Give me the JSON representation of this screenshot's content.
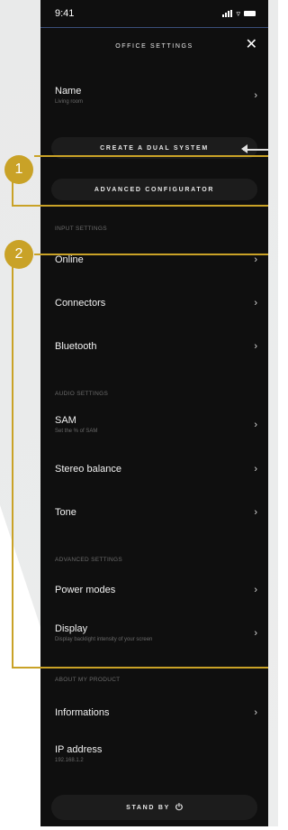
{
  "status_bar": {
    "time": "9:41"
  },
  "header": {
    "title": "OFFICE SETTINGS",
    "close_icon": "close-icon"
  },
  "name_row": {
    "label": "Name",
    "value": "Living room"
  },
  "dual_system_button": {
    "label": "CREATE A DUAL SYSTEM"
  },
  "advanced_configurator_button": {
    "label": "ADVANCED CONFIGURATOR"
  },
  "sections": {
    "input": "INPUT SETTINGS",
    "audio": "AUDIO SETTINGS",
    "advanced": "ADVANCED SETTINGS",
    "about": "ABOUT MY PRODUCT"
  },
  "input_items": [
    {
      "label": "Online"
    },
    {
      "label": "Connectors"
    },
    {
      "label": "Bluetooth"
    }
  ],
  "audio_items": [
    {
      "label": "SAM",
      "sub": "Set the % of SAM"
    },
    {
      "label": "Stereo balance"
    },
    {
      "label": "Tone"
    }
  ],
  "advanced_items": [
    {
      "label": "Power modes"
    },
    {
      "label": "Display",
      "sub": "Display backlight intensity of your screen"
    }
  ],
  "about_items": [
    {
      "label": "Informations"
    },
    {
      "label": "IP address",
      "value": "192.168.1.2"
    }
  ],
  "standby_button": {
    "label": "STAND BY"
  },
  "annotations": {
    "badge1": "1",
    "badge2": "2"
  },
  "colors": {
    "accent": "#c9a227",
    "background": "#0f0f0f",
    "status_divider": "#3a4e7a"
  }
}
